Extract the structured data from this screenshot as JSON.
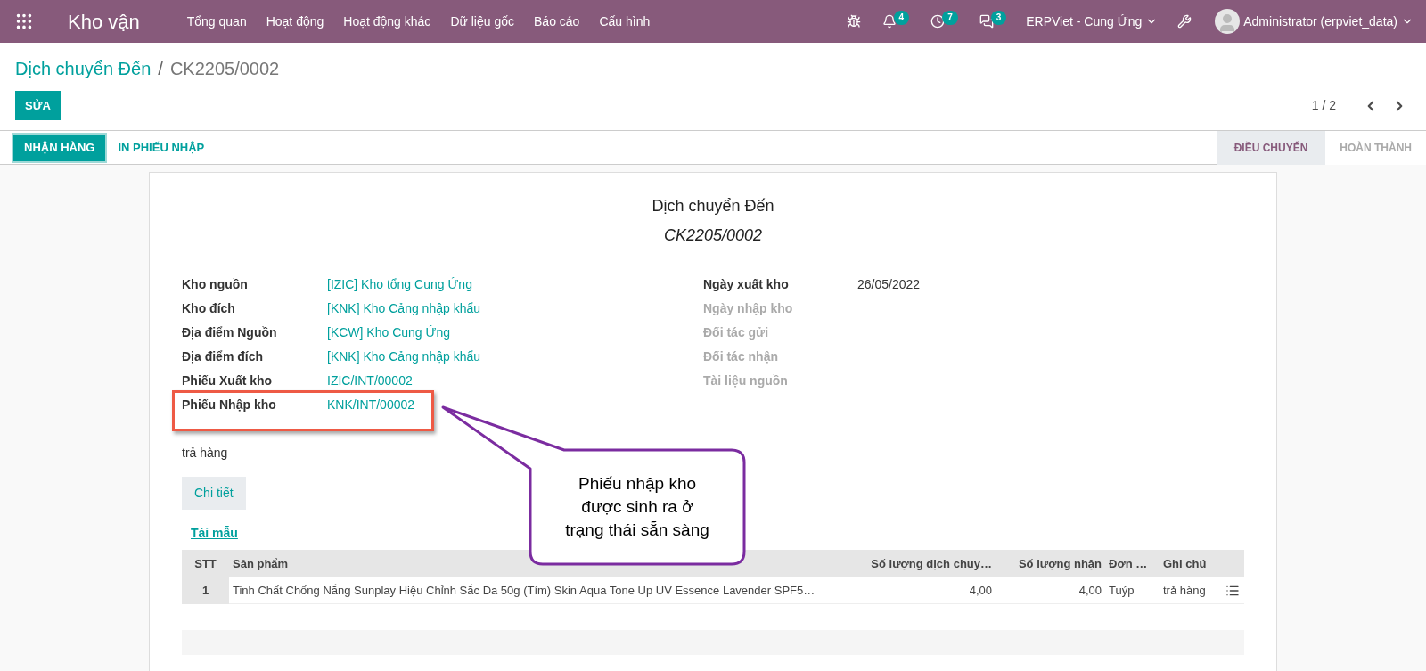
{
  "navbar": {
    "app_name": "Kho vận",
    "menu": [
      {
        "label": "Tổng quan"
      },
      {
        "label": "Hoạt động"
      },
      {
        "label": "Hoạt động khác"
      },
      {
        "label": "Dữ liệu gốc"
      },
      {
        "label": "Báo cáo"
      },
      {
        "label": "Cấu hình"
      }
    ],
    "systray": [
      {
        "kind": "debug"
      },
      {
        "kind": "bell",
        "count": "4"
      },
      {
        "kind": "activity",
        "count": "7"
      },
      {
        "kind": "messages",
        "count": "3"
      }
    ],
    "company": "ERPViet - Cung Ứng",
    "user": "Administrator (erpviet_data)"
  },
  "breadcrumb": {
    "parent": "Dịch chuyển Đến",
    "separator": "/",
    "current": "CK2205/0002"
  },
  "edit_button": "SỬA",
  "pager": {
    "text": "1 / 2"
  },
  "actions": [
    {
      "label": "NHẬN HÀNG",
      "primary": true
    },
    {
      "label": "IN PHIẾU NHẬP",
      "primary": false
    }
  ],
  "stages": [
    {
      "label": "ĐIỀU CHUYỂN",
      "selected": true
    },
    {
      "label": "HOÀN THÀNH",
      "selected": false
    }
  ],
  "sheet": {
    "title": "Dịch chuyển Đến",
    "subtitle": "CK2205/0002",
    "left_fields": [
      {
        "label": "Kho nguồn",
        "value": "[IZIC] Kho tổng Cung Ứng"
      },
      {
        "label": "Kho đích",
        "value": "[KNK] Kho Cảng nhập khẩu"
      },
      {
        "label": "Địa điểm Nguồn",
        "value": "[KCW] Kho Cung Ứng"
      },
      {
        "label": "Địa điểm đích",
        "value": "[KNK] Kho Cảng nhập khẩu"
      },
      {
        "label": "Phiếu Xuất kho",
        "value": "IZIC/INT/00002"
      },
      {
        "label": "Phiếu Nhập kho",
        "value": "KNK/INT/00002"
      }
    ],
    "right_fields": [
      {
        "label": "Ngày xuất kho",
        "value": "26/05/2022",
        "muted": false
      },
      {
        "label": "Ngày nhập kho",
        "muted": true
      },
      {
        "label": "Đối tác gửi",
        "muted": true
      },
      {
        "label": "Đối tác nhận",
        "muted": true
      },
      {
        "label": "Tài liệu nguồn",
        "muted": true
      }
    ],
    "note": "trả hàng",
    "detail_button": "Chi tiết",
    "template_link": "Tải mẫu",
    "table": {
      "columns": [
        "STT",
        "Sản phẩm",
        "Số lượng dịch chuy…",
        "Số lượng nhận",
        "Đơn …",
        "Ghi chú"
      ],
      "rows": [
        [
          "1",
          "Tinh Chất Chống Nắng Sunplay Hiệu Chỉnh Sắc Da 50g (Tím) Skin Aqua Tone Up UV Essence Lavender SPF5…",
          "4,00",
          "4,00",
          "Tuýp",
          "trả hàng"
        ]
      ]
    }
  },
  "callout": {
    "text": "Phiếu nhập kho\nđược sinh ra ở\ntrạng thái sẵn sàng"
  }
}
